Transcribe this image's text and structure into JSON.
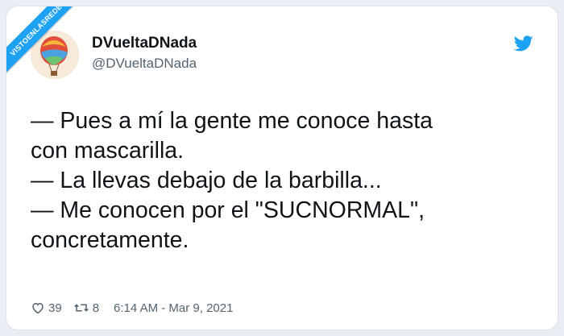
{
  "watermark": "VISTOENLASREDES",
  "tweet": {
    "display_name": "DVueltaDNada",
    "username": "@DVueltaDNada",
    "lines": [
      "— Pues a mí la gente me conoce hasta",
      "con mascarilla.",
      "— La llevas debajo de la barbilla...",
      "— Me conocen por el \"SUCNORMAL\",",
      "concretamente."
    ],
    "likes": "39",
    "retweets": "8",
    "timestamp": "6:14 AM - Mar 9, 2021"
  },
  "icons": {
    "brand": "twitter-bird-icon",
    "like": "heart-icon",
    "retweet": "retweet-icon"
  },
  "colors": {
    "brand": "#1da1f2",
    "text": "#0f1419",
    "muted": "#536471"
  }
}
